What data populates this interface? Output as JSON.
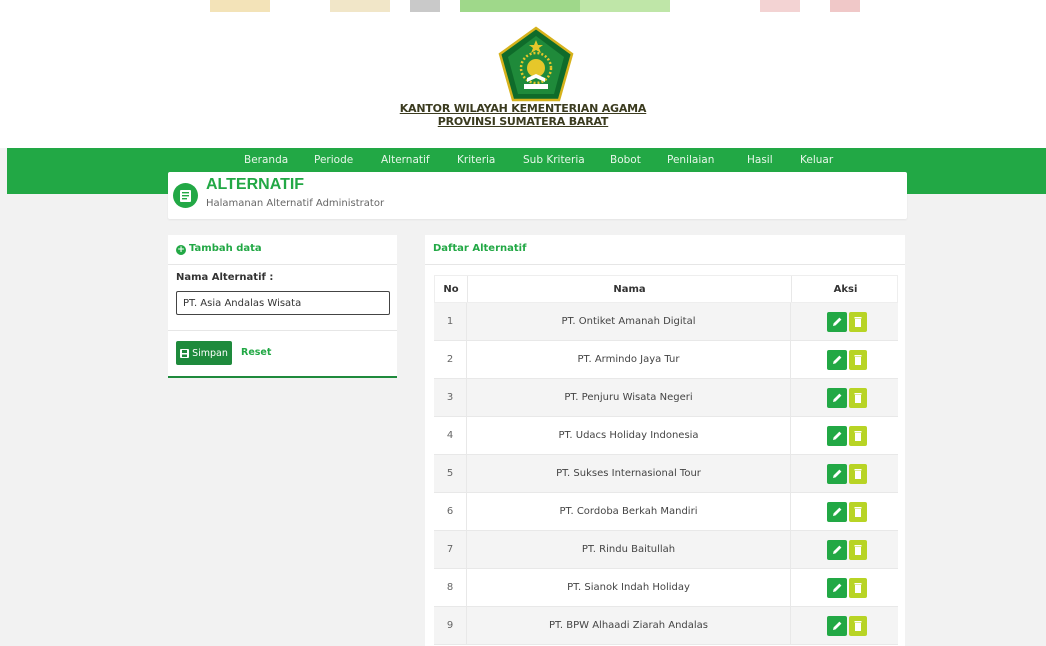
{
  "header": {
    "office_line1": "KANTOR WILAYAH KEMENTERIAN AGAMA",
    "office_line2": "PROVINSI SUMATERA BARAT"
  },
  "nav": {
    "items": [
      "Beranda",
      "Periode",
      "Alternatif",
      "Kriteria",
      "Sub Kriteria",
      "Bobot",
      "Penilaian",
      "Hasil",
      "Keluar"
    ]
  },
  "page": {
    "title": "ALTERNATIF",
    "subtitle": "Halamanan Alternatif Administrator",
    "icon": "book-icon"
  },
  "form": {
    "title": "Tambah data",
    "label": "Nama Alternatif :",
    "value": "PT. Asia Andalas Wisata",
    "save_label": "Simpan",
    "reset_label": "Reset"
  },
  "list": {
    "title": "Daftar Alternatif",
    "columns": [
      "No",
      "Nama",
      "Aksi"
    ],
    "rows": [
      {
        "no": "1",
        "nama": "PT. Ontiket Amanah Digital"
      },
      {
        "no": "2",
        "nama": "PT. Armindo Jaya Tur"
      },
      {
        "no": "3",
        "nama": "PT. Penjuru Wisata Negeri"
      },
      {
        "no": "4",
        "nama": "PT. Udacs Holiday Indonesia"
      },
      {
        "no": "5",
        "nama": "PT. Sukses Internasional Tour"
      },
      {
        "no": "6",
        "nama": "PT. Cordoba Berkah Mandiri"
      },
      {
        "no": "7",
        "nama": "PT. Rindu Baitullah"
      },
      {
        "no": "8",
        "nama": "PT. Sianok Indah Holiday"
      },
      {
        "no": "9",
        "nama": "PT. BPW Alhaadi Ziarah Andalas"
      }
    ]
  },
  "colors": {
    "primary": "#22a845",
    "primary_dark": "#1e8a3c",
    "delete": "#b8d425"
  }
}
